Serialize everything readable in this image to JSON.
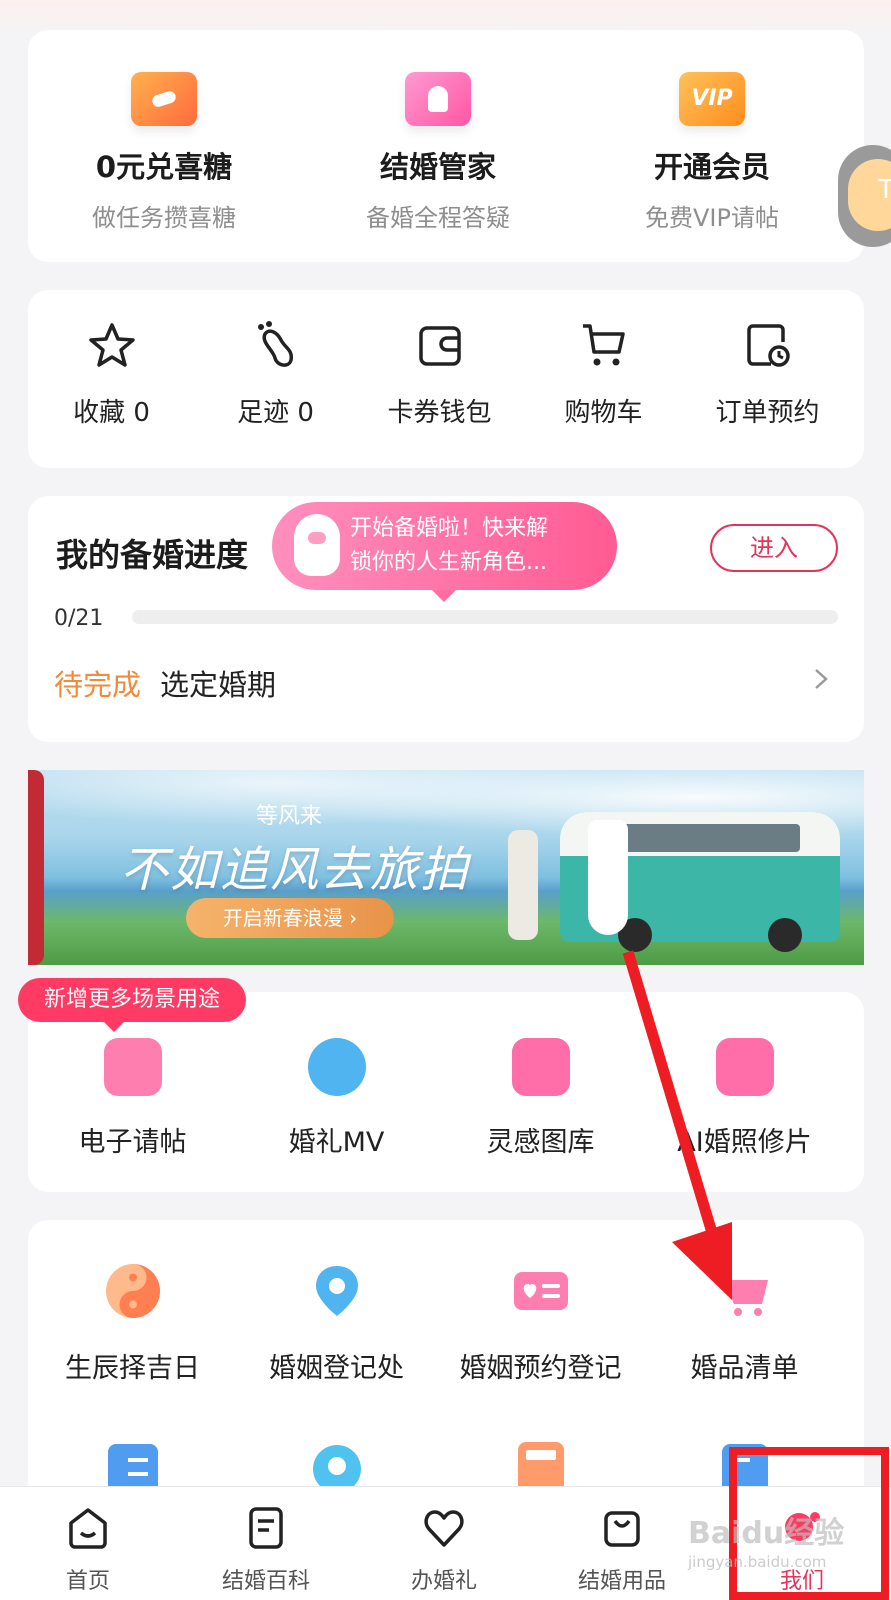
{
  "promos": [
    {
      "title": "0元兑喜糖",
      "sub": "做任务攒喜糖",
      "icon": "candy-icon"
    },
    {
      "title": "结婚管家",
      "sub": "备婚全程答疑",
      "icon": "steward-icon"
    },
    {
      "title": "开通会员",
      "sub": "免费VIP请帖",
      "icon": "vip-icon",
      "badge": "VIP"
    }
  ],
  "side_pill_text": "T",
  "tools": [
    {
      "label": "收藏 0",
      "icon": "star-icon"
    },
    {
      "label": "足迹 0",
      "icon": "footprint-icon"
    },
    {
      "label": "卡券钱包",
      "icon": "wallet-icon"
    },
    {
      "label": "购物车",
      "icon": "cart-icon"
    },
    {
      "label": "订单预约",
      "icon": "order-clock-icon"
    }
  ],
  "progress": {
    "title": "我的备婚进度",
    "bubble_line1": "开始备婚啦！快来解",
    "bubble_line2": "锁你的人生新角色...",
    "enter_label": "进入",
    "count": "0/21",
    "fraction": 0,
    "status": "待完成",
    "task": "选定婚期"
  },
  "banner": {
    "small_text": "等风来",
    "big_text": "不如追风去旅拍",
    "cta": "开启新春浪漫 ›"
  },
  "services_tag": "新增更多场景用途",
  "services": [
    {
      "label": "电子请帖",
      "icon": "invitation-icon",
      "color": "#ff7eb0"
    },
    {
      "label": "婚礼MV",
      "icon": "film-reel-icon",
      "color": "#4fb4f0"
    },
    {
      "label": "灵感图库",
      "icon": "gallery-icon",
      "color": "#ff6ea8"
    },
    {
      "label": "AI婚照修片",
      "icon": "camera-icon",
      "color": "#ff6ea8"
    }
  ],
  "more": [
    {
      "label": "生辰择吉日",
      "icon": "yinyang-icon"
    },
    {
      "label": "婚姻登记处",
      "icon": "location-pin-icon"
    },
    {
      "label": "婚姻预约登记",
      "icon": "id-card-icon"
    },
    {
      "label": "婚品清单",
      "icon": "pink-cart-icon"
    }
  ],
  "nav": [
    {
      "label": "首页",
      "icon": "home-icon"
    },
    {
      "label": "结婚百科",
      "icon": "document-icon"
    },
    {
      "label": "办婚礼",
      "icon": "heart-icon"
    },
    {
      "label": "结婚用品",
      "icon": "shopping-bag-icon"
    },
    {
      "label": "我们",
      "icon": "couple-icon"
    }
  ],
  "watermark": "Baidu经验",
  "watermark_sub": "jingyan.baidu.com",
  "colors": {
    "accent": "#e6335a",
    "pending": "#f08a3c",
    "annotation": "#ee1d24"
  }
}
